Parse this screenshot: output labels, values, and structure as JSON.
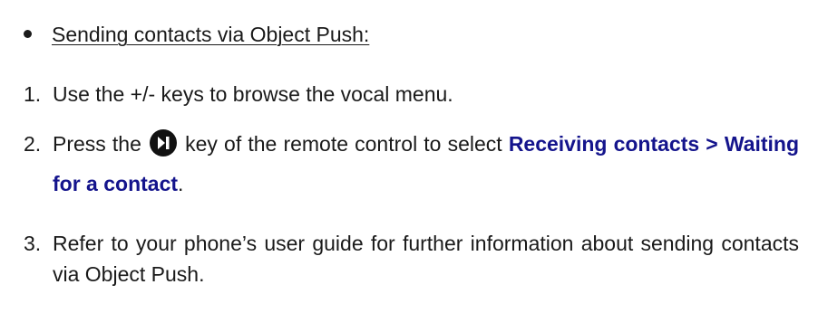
{
  "heading": {
    "text": "Sending contacts via Object Push:"
  },
  "steps": [
    {
      "number": "1.",
      "text": "Use the +/- keys to browse the vocal menu."
    },
    {
      "number": "2.",
      "before_icon": "Press the",
      "icon": "play-next-key-icon",
      "after_icon": "key of the remote control to select",
      "highlight": "Receiving contacts > Waiting for a contact",
      "end": "."
    },
    {
      "number": "3.",
      "text": "Refer to your phone’s user guide for further information about sending contacts via Object Push."
    }
  ],
  "colors": {
    "text": "#1a1a1a",
    "highlight": "#14148c",
    "icon": "#121212"
  }
}
